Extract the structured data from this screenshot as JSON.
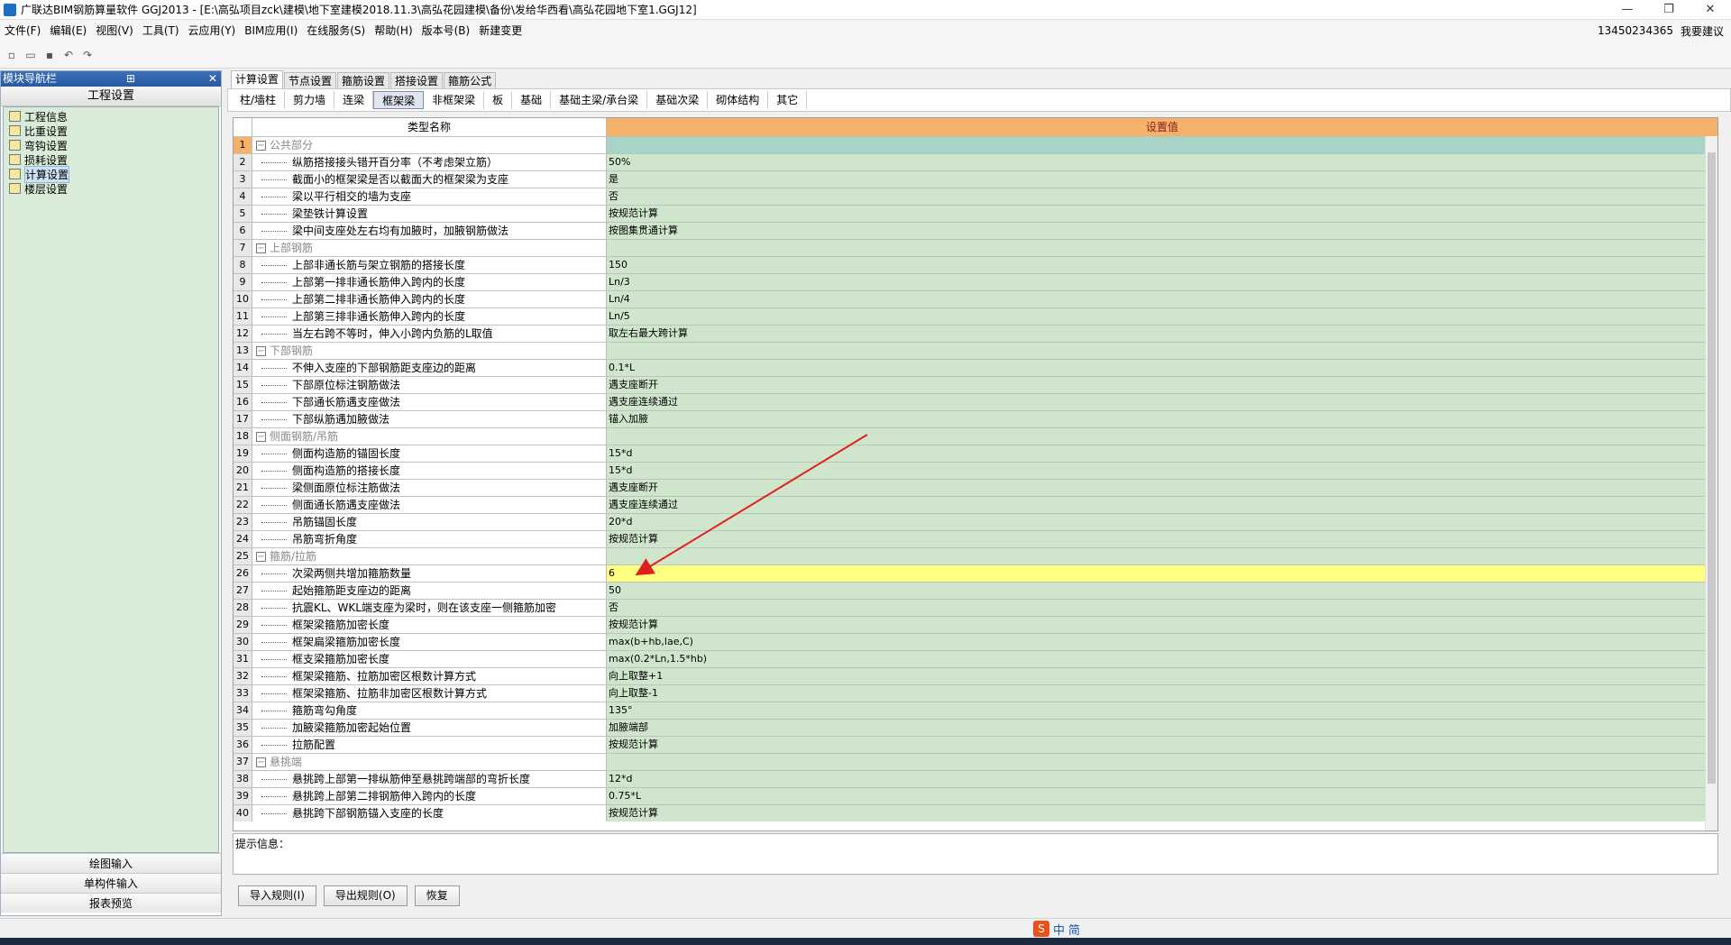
{
  "window": {
    "title": "广联达BIM钢筋算量软件 GGJ2013 - [E:\\高弘项目zck\\建模\\地下室建模2018.11.3\\高弘花园建模\\备份\\发给华西看\\高弘花园地下室1.GGJ12]",
    "minimize": "—",
    "restore": "❐",
    "close": "✕"
  },
  "menu": {
    "items": [
      "文件(F)",
      "编辑(E)",
      "视图(V)",
      "工具(T)",
      "云应用(Y)",
      "BIM应用(I)",
      "在线服务(S)",
      "帮助(H)",
      "版本号(B)",
      "新建变更"
    ],
    "account": "13450234365",
    "want_suggest": "我要建议"
  },
  "nav": {
    "header": "模块导航栏",
    "pin": "⊞",
    "close": "✕",
    "title": "工程设置",
    "items": [
      "工程信息",
      "比重设置",
      "弯钩设置",
      "损耗设置",
      "计算设置",
      "楼层设置"
    ],
    "bottom": [
      "绘图输入",
      "单构件输入",
      "报表预览"
    ]
  },
  "tabs1": [
    "计算设置",
    "节点设置",
    "箍筋设置",
    "搭接设置",
    "箍筋公式"
  ],
  "tabs2": [
    "柱/墙柱",
    "剪力墙",
    "连梁",
    "框架梁",
    "非框架梁",
    "板",
    "基础",
    "基础主梁/承台梁",
    "基础次梁",
    "砌体结构",
    "其它"
  ],
  "grid": {
    "col_name": "类型名称",
    "col_value": "设置值",
    "rows": [
      {
        "n": "1",
        "name": "公共部分",
        "value": "",
        "group": true
      },
      {
        "n": "2",
        "name": "纵筋搭接接头错开百分率（不考虑架立筋）",
        "value": "50%"
      },
      {
        "n": "3",
        "name": "截面小的框架梁是否以截面大的框架梁为支座",
        "value": "是"
      },
      {
        "n": "4",
        "name": "梁以平行相交的墙为支座",
        "value": "否"
      },
      {
        "n": "5",
        "name": "梁垫铁计算设置",
        "value": "按规范计算"
      },
      {
        "n": "6",
        "name": "梁中间支座处左右均有加腋时，加腋钢筋做法",
        "value": "按图集贯通计算"
      },
      {
        "n": "7",
        "name": "上部钢筋",
        "value": "",
        "group": true
      },
      {
        "n": "8",
        "name": "上部非通长筋与架立钢筋的搭接长度",
        "value": "150"
      },
      {
        "n": "9",
        "name": "上部第一排非通长筋伸入跨内的长度",
        "value": "Ln/3"
      },
      {
        "n": "10",
        "name": "上部第二排非通长筋伸入跨内的长度",
        "value": "Ln/4"
      },
      {
        "n": "11",
        "name": "上部第三排非通长筋伸入跨内的长度",
        "value": "Ln/5"
      },
      {
        "n": "12",
        "name": "当左右跨不等时，伸入小跨内负筋的L取值",
        "value": "取左右最大跨计算"
      },
      {
        "n": "13",
        "name": "下部钢筋",
        "value": "",
        "group": true
      },
      {
        "n": "14",
        "name": "不伸入支座的下部钢筋距支座边的距离",
        "value": "0.1*L"
      },
      {
        "n": "15",
        "name": "下部原位标注钢筋做法",
        "value": "遇支座断开"
      },
      {
        "n": "16",
        "name": "下部通长筋遇支座做法",
        "value": "遇支座连续通过"
      },
      {
        "n": "17",
        "name": "下部纵筋遇加腋做法",
        "value": "锚入加腋"
      },
      {
        "n": "18",
        "name": "侧面钢筋/吊筋",
        "value": "",
        "group": true
      },
      {
        "n": "19",
        "name": "侧面构造筋的锚固长度",
        "value": "15*d"
      },
      {
        "n": "20",
        "name": "侧面构造筋的搭接长度",
        "value": "15*d"
      },
      {
        "n": "21",
        "name": "梁侧面原位标注筋做法",
        "value": "遇支座断开"
      },
      {
        "n": "22",
        "name": "侧面通长筋遇支座做法",
        "value": "遇支座连续通过"
      },
      {
        "n": "23",
        "name": "吊筋锚固长度",
        "value": "20*d"
      },
      {
        "n": "24",
        "name": "吊筋弯折角度",
        "value": "按规范计算"
      },
      {
        "n": "25",
        "name": "箍筋/拉筋",
        "value": "",
        "group": true
      },
      {
        "n": "26",
        "name": "次梁两侧共增加箍筋数量",
        "value": "6",
        "hl": true
      },
      {
        "n": "27",
        "name": "起始箍筋距支座边的距离",
        "value": "50"
      },
      {
        "n": "28",
        "name": "抗震KL、WKL端支座为梁时，则在该支座一侧箍筋加密",
        "value": "否"
      },
      {
        "n": "29",
        "name": "框架梁箍筋加密长度",
        "value": "按规范计算"
      },
      {
        "n": "30",
        "name": "框架扁梁箍筋加密长度",
        "value": "max(b+hb,lae,C)"
      },
      {
        "n": "31",
        "name": "框支梁箍筋加密长度",
        "value": "max(0.2*Ln,1.5*hb)"
      },
      {
        "n": "32",
        "name": "框架梁箍筋、拉筋加密区根数计算方式",
        "value": "向上取整+1"
      },
      {
        "n": "33",
        "name": "框架梁箍筋、拉筋非加密区根数计算方式",
        "value": "向上取整-1"
      },
      {
        "n": "34",
        "name": "箍筋弯勾角度",
        "value": "135°"
      },
      {
        "n": "35",
        "name": "加腋梁箍筋加密起始位置",
        "value": "加腋端部"
      },
      {
        "n": "36",
        "name": "拉筋配置",
        "value": "按规范计算"
      },
      {
        "n": "37",
        "name": "悬挑端",
        "value": "",
        "group": true
      },
      {
        "n": "38",
        "name": "悬挑跨上部第一排纵筋伸至悬挑跨端部的弯折长度",
        "value": "12*d"
      },
      {
        "n": "39",
        "name": "悬挑跨上部第二排钢筋伸入跨内的长度",
        "value": "0.75*L"
      },
      {
        "n": "40",
        "name": "悬挑跨下部钢筋锚入支座的长度",
        "value": "按规范计算"
      }
    ]
  },
  "hint": {
    "label": "提示信息："
  },
  "buttons": {
    "import": "导入规则(I)",
    "export": "导出规则(O)",
    "restore": "恢复"
  },
  "ime": {
    "logo": "S",
    "lang": "中",
    "mode": "简"
  },
  "colors": {
    "value_bg": "#cfe6cc",
    "header_bg": "#f6b26b",
    "highlight": "#ffff80",
    "arrow": "#e02020"
  }
}
